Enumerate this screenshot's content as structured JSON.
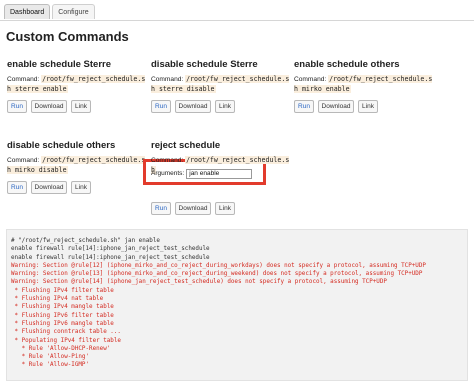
{
  "tabs": [
    {
      "label": "Dashboard",
      "active": true
    },
    {
      "label": "Configure",
      "active": false
    }
  ],
  "page_title": "Custom Commands",
  "command_label": "Command:",
  "buttons": {
    "run": "Run",
    "download": "Download",
    "link": "Link"
  },
  "commands": [
    {
      "title": "enable schedule Sterre",
      "path": "/root/fw_reject_schedule.sh sterre enable"
    },
    {
      "title": "disable schedule Sterre",
      "path": "/root/fw_reject_schedule.sh sterre disable"
    },
    {
      "title": "enable schedule others",
      "path": "/root/fw_reject_schedule.sh mirko enable"
    },
    {
      "title": "disable schedule others",
      "path": "/root/fw_reject_schedule.sh mirko disable"
    },
    {
      "title": "reject schedule",
      "path": "/root/fw_reject_schedule.sh"
    }
  ],
  "arguments": {
    "label": "Arguments:",
    "value": "jan enable"
  },
  "console": {
    "lines": [
      {
        "text": "# \"/root/fw_reject_schedule.sh\" jan enable",
        "level": "normal"
      },
      {
        "text": "enable firewall rule[14]:iphone_jan_reject_test_schedule",
        "level": "normal"
      },
      {
        "text": "enable firewall rule[14]:iphone_jan_reject_test_schedule",
        "level": "normal"
      },
      {
        "text": "Warning: Section @rule[12] (iphone_mirko_and_co_reject_during_workdays) does not specify a protocol, assuming TCP+UDP",
        "level": "warning"
      },
      {
        "text": "Warning: Section @rule[13] (iphone_mirko_and_co_reject_during_weekend) does not specify a protocol, assuming TCP+UDP",
        "level": "warning"
      },
      {
        "text": "Warning: Section @rule[14] (iphone_jan_reject_test_schedule) does not specify a protocol, assuming TCP+UDP",
        "level": "warning"
      },
      {
        "text": " * Flushing IPv4 filter table",
        "level": "warning"
      },
      {
        "text": " * Flushing IPv4 nat table",
        "level": "warning"
      },
      {
        "text": " * Flushing IPv4 mangle table",
        "level": "warning"
      },
      {
        "text": " * Flushing IPv6 filter table",
        "level": "warning"
      },
      {
        "text": " * Flushing IPv6 mangle table",
        "level": "warning"
      },
      {
        "text": " * Flushing conntrack table ...",
        "level": "warning"
      },
      {
        "text": " * Populating IPv4 filter table",
        "level": "warning"
      },
      {
        "text": "   * Rule 'Allow-DHCP-Renew'",
        "level": "warning"
      },
      {
        "text": "   * Rule 'Allow-Ping'",
        "level": "warning"
      },
      {
        "text": "   * Rule 'Allow-IGMP'",
        "level": "warning"
      }
    ]
  }
}
